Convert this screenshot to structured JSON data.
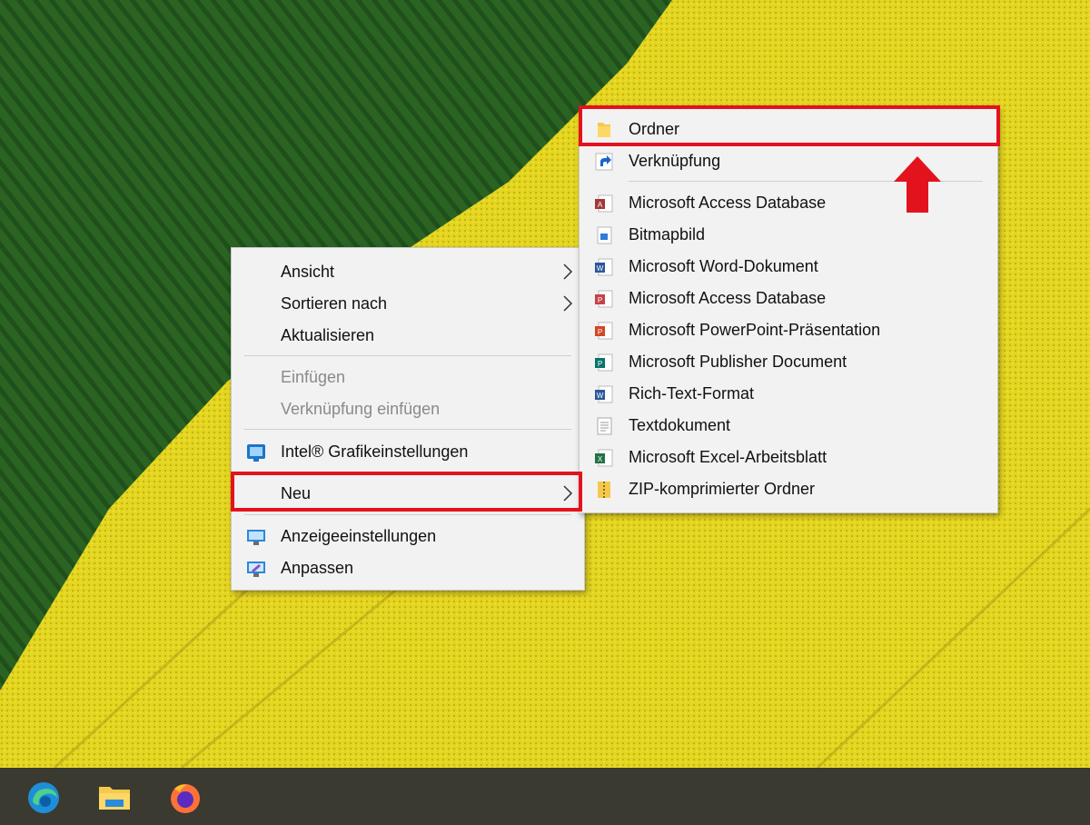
{
  "main_menu": {
    "items": [
      {
        "label": "Ansicht",
        "has_submenu": true,
        "enabled": true
      },
      {
        "label": "Sortieren nach",
        "has_submenu": true,
        "enabled": true
      },
      {
        "label": "Aktualisieren",
        "has_submenu": false,
        "enabled": true
      },
      {
        "label": "Einfügen",
        "has_submenu": false,
        "enabled": false
      },
      {
        "label": "Verknüpfung einfügen",
        "has_submenu": false,
        "enabled": false
      },
      {
        "label": "Intel® Grafikeinstellungen",
        "icon": "intel-graphics-icon",
        "enabled": true
      },
      {
        "label": "Neu",
        "has_submenu": true,
        "enabled": true,
        "highlighted": true
      },
      {
        "label": "Anzeigeeinstellungen",
        "icon": "display-settings-icon",
        "enabled": true
      },
      {
        "label": "Anpassen",
        "icon": "personalize-icon",
        "enabled": true
      }
    ]
  },
  "sub_menu": {
    "items": [
      {
        "label": "Ordner",
        "icon": "folder-icon",
        "highlighted": true
      },
      {
        "label": "Verknüpfung",
        "icon": "shortcut-icon"
      },
      {
        "label": "Microsoft Access Database",
        "icon": "access-icon"
      },
      {
        "label": "Bitmapbild",
        "icon": "bitmap-icon"
      },
      {
        "label": "Microsoft Word-Dokument",
        "icon": "word-icon"
      },
      {
        "label": "Microsoft Access Database",
        "icon": "access-doc-icon"
      },
      {
        "label": "Microsoft PowerPoint-Präsentation",
        "icon": "powerpoint-icon"
      },
      {
        "label": "Microsoft Publisher Document",
        "icon": "publisher-icon"
      },
      {
        "label": "Rich-Text-Format",
        "icon": "rtf-icon"
      },
      {
        "label": "Textdokument",
        "icon": "text-document-icon"
      },
      {
        "label": "Microsoft Excel-Arbeitsblatt",
        "icon": "excel-icon"
      },
      {
        "label": "ZIP-komprimierter Ordner",
        "icon": "zip-folder-icon"
      }
    ]
  },
  "taskbar": {
    "apps": [
      "edge-icon",
      "file-explorer-icon",
      "firefox-icon"
    ]
  },
  "colors": {
    "highlight": "#e3131e",
    "menu_bg": "#f2f2f2",
    "taskbar": "#3a3a31",
    "field_green": "#245a1e",
    "field_yellow": "#e2d21f"
  }
}
